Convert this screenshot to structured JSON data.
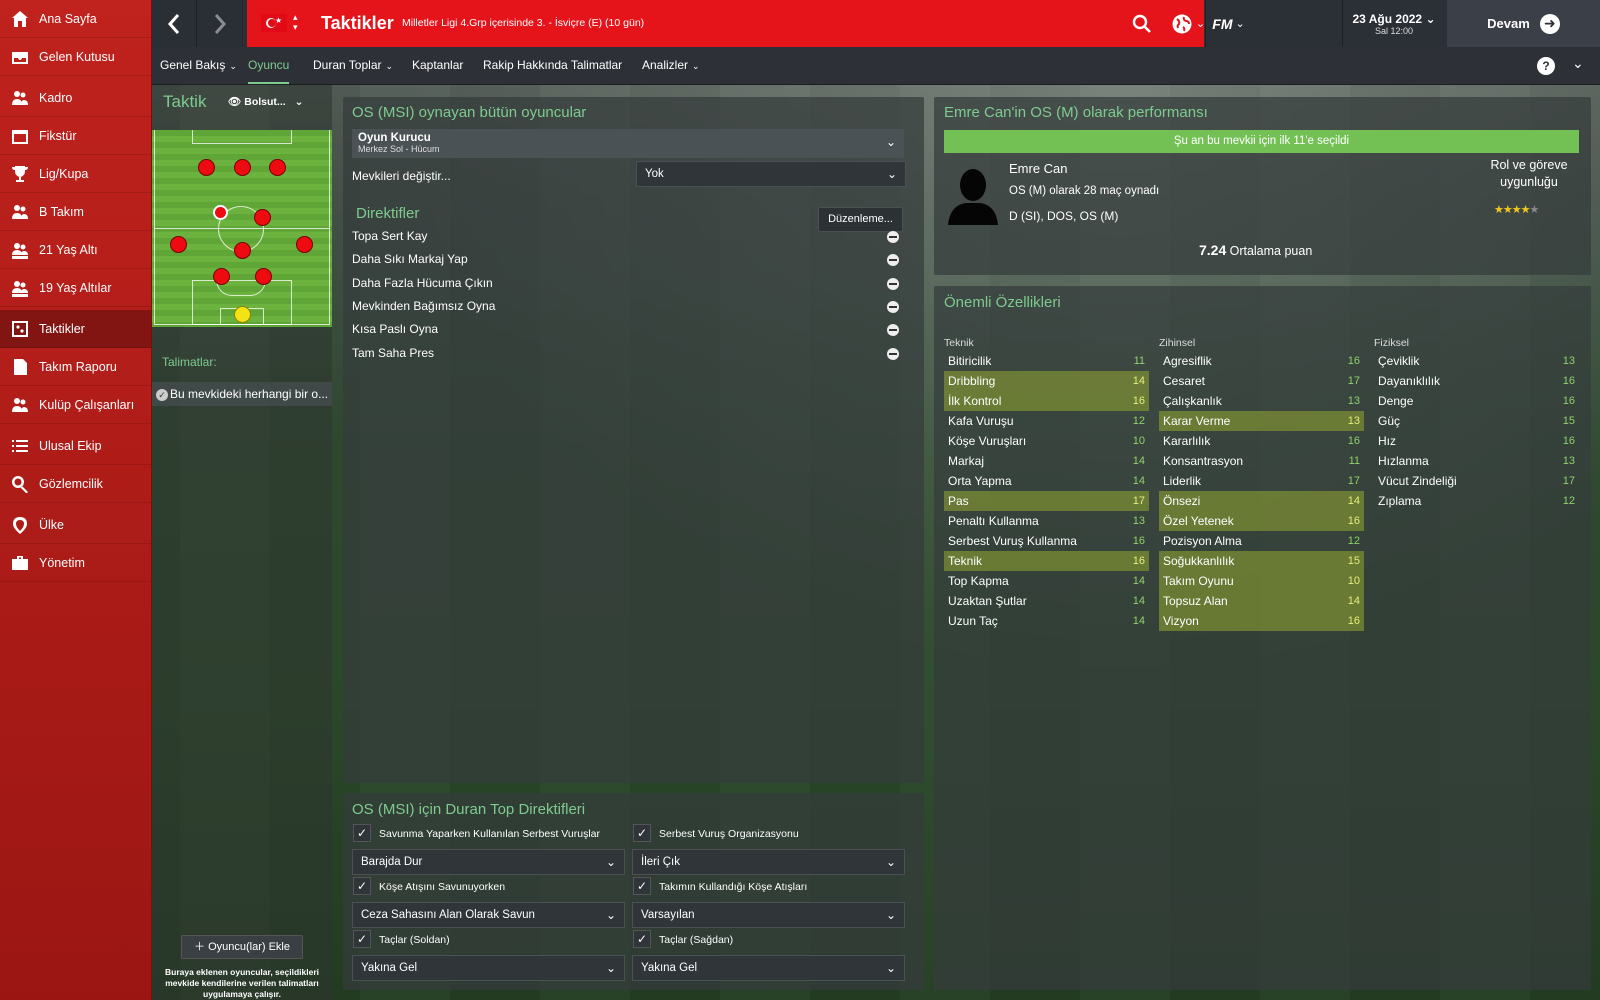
{
  "sidebar": {
    "items": [
      {
        "label": "Ana Sayfa",
        "icon": "home-icon"
      },
      {
        "label": "Gelen Kutusu",
        "icon": "inbox-icon"
      },
      {
        "label": "Kadro",
        "icon": "squad-icon"
      },
      {
        "label": "Fikstür",
        "icon": "calendar-icon"
      },
      {
        "label": "Lig/Kupa",
        "icon": "trophy-icon"
      },
      {
        "label": "B Takım",
        "icon": "team-b-icon"
      },
      {
        "label": "21 Yaş Altı",
        "icon": "u21-icon"
      },
      {
        "label": "19 Yaş Altılar",
        "icon": "u19-icon"
      },
      {
        "label": "Taktikler",
        "icon": "tactics-icon"
      },
      {
        "label": "Takım Raporu",
        "icon": "report-icon"
      },
      {
        "label": "Kulüp Çalışanları",
        "icon": "staff-icon"
      },
      {
        "label": "Ulusal Ekip",
        "icon": "list-icon"
      },
      {
        "label": "Gözlemcilik",
        "icon": "scout-search-icon"
      },
      {
        "label": "Ülke",
        "icon": "location-pin-icon"
      },
      {
        "label": "Yönetim",
        "icon": "briefcase-icon"
      }
    ],
    "active_index": 8
  },
  "topbar": {
    "title": "Taktikler",
    "subtitle": "Milletler Ligi 4.Grp içerisinde 3. - İsviçre (E) (10 gün)",
    "brand": "FM",
    "date": "23 Ağu 2022",
    "day_time": "Sal 12:00",
    "continue": "Devam"
  },
  "tabs": [
    {
      "label": "Genel Bakış",
      "dropdown": true
    },
    {
      "label": "Oyuncu",
      "dropdown": false,
      "active": true
    },
    {
      "label": "Duran Toplar",
      "dropdown": true
    },
    {
      "label": "Kaptanlar",
      "dropdown": false
    },
    {
      "label": "Rakip Hakkında Talimatlar",
      "dropdown": false
    },
    {
      "label": "Analizler",
      "dropdown": true
    }
  ],
  "tactic_panel": {
    "title": "Taktik",
    "view_select": "Bolsut...",
    "instructions_label": "Talimatlar:",
    "instruction_item": "Bu mevkideki herhangi bir o...",
    "add_button": "Oyuncu(lar) Ekle",
    "note": "Buraya eklenen oyuncular, seçildikleri mevkide kendilerine verilen talimatları uygulamaya çalışır."
  },
  "center": {
    "title": "OS (MSI) oynayan bütün oyuncular",
    "role_name": "Oyun Kurucu",
    "role_detail": "Merkez Sol - Hücum",
    "swap_label": "Mevkileri değiştir...",
    "swap_value": "Yok",
    "directives_title": "Direktifler",
    "edit_button": "Düzenleme...",
    "directives": [
      "Topa Sert Kay",
      "Daha Sıkı Markaj Yap",
      "Daha Fazla Hücuma Çıkın",
      "Mevkinden Bağımsız Oyna",
      "Kısa Paslı Oyna",
      "Tam Saha Pres"
    ]
  },
  "set_pieces": {
    "title": "OS (MSI) için Duran Top Direktifleri",
    "left": [
      {
        "check": "Savunma Yaparken Kullanılan Serbest Vuruşlar",
        "value": "Barajda Dur"
      },
      {
        "check": "Köşe Atışını Savunuyorken",
        "value": "Ceza Sahasını Alan Olarak Savun"
      },
      {
        "check": "Taçlar (Soldan)",
        "value": "Yakına Gel"
      }
    ],
    "right": [
      {
        "check": "Serbest Vuruş Organizasyonu",
        "value": "İleri Çık"
      },
      {
        "check": "Takımın Kullandığı Köşe Atışları",
        "value": "Varsayılan"
      },
      {
        "check": "Taçlar (Sağdan)",
        "value": "Yakına Gel"
      }
    ]
  },
  "performance": {
    "title": "Emre Can'in OS (M) olarak performansı",
    "banner": "Şu an bu mevkii için ilk 11'e seçildi",
    "player_name": "Emre Can",
    "appearances": "OS (M) olarak 28 maç oynadı",
    "positions": "D (SI), DOS, OS (M)",
    "suitability_label": "Rol ve göreve uygunluğu",
    "stars": 4,
    "stars_max": 5,
    "avg_value": "7.24",
    "avg_label": "Ortalama puan"
  },
  "attributes": {
    "title": "Önemli Özellikleri",
    "technical": {
      "heading": "Teknik",
      "rows": [
        {
          "n": "Bitiricilik",
          "v": "11",
          "hl": false
        },
        {
          "n": "Dribbling",
          "v": "14",
          "hl": true
        },
        {
          "n": "İlk Kontrol",
          "v": "16",
          "hl": true
        },
        {
          "n": "Kafa Vuruşu",
          "v": "12",
          "hl": false
        },
        {
          "n": "Köşe Vuruşları",
          "v": "10",
          "hl": false
        },
        {
          "n": "Markaj",
          "v": "14",
          "hl": false
        },
        {
          "n": "Orta Yapma",
          "v": "14",
          "hl": false
        },
        {
          "n": "Pas",
          "v": "17",
          "hl": true
        },
        {
          "n": "Penaltı Kullanma",
          "v": "13",
          "hl": false
        },
        {
          "n": "Serbest Vuruş Kullanma",
          "v": "16",
          "hl": false
        },
        {
          "n": "Teknik",
          "v": "16",
          "hl": true
        },
        {
          "n": "Top Kapma",
          "v": "14",
          "hl": false
        },
        {
          "n": "Uzaktan Şutlar",
          "v": "14",
          "hl": false
        },
        {
          "n": "Uzun Taç",
          "v": "14",
          "hl": false
        }
      ]
    },
    "mental": {
      "heading": "Zihinsel",
      "rows": [
        {
          "n": "Agresiflik",
          "v": "16",
          "hl": false
        },
        {
          "n": "Cesaret",
          "v": "17",
          "hl": false
        },
        {
          "n": "Çalışkanlık",
          "v": "13",
          "hl": false
        },
        {
          "n": "Karar Verme",
          "v": "13",
          "hl": true
        },
        {
          "n": "Kararlılık",
          "v": "16",
          "hl": false
        },
        {
          "n": "Konsantrasyon",
          "v": "11",
          "hl": false
        },
        {
          "n": "Liderlik",
          "v": "17",
          "hl": false
        },
        {
          "n": "Önsezi",
          "v": "14",
          "hl": true
        },
        {
          "n": "Özel Yetenek",
          "v": "16",
          "hl": true
        },
        {
          "n": "Pozisyon Alma",
          "v": "12",
          "hl": false
        },
        {
          "n": "Soğukkanlılık",
          "v": "15",
          "hl": true
        },
        {
          "n": "Takım Oyunu",
          "v": "10",
          "hl": true
        },
        {
          "n": "Topsuz Alan",
          "v": "14",
          "hl": true
        },
        {
          "n": "Vizyon",
          "v": "16",
          "hl": true
        }
      ]
    },
    "physical": {
      "heading": "Fiziksel",
      "rows": [
        {
          "n": "Çeviklik",
          "v": "13",
          "hl": false
        },
        {
          "n": "Dayanıklılık",
          "v": "16",
          "hl": false
        },
        {
          "n": "Denge",
          "v": "16",
          "hl": false
        },
        {
          "n": "Güç",
          "v": "15",
          "hl": false
        },
        {
          "n": "Hız",
          "v": "16",
          "hl": false
        },
        {
          "n": "Hızlanma",
          "v": "13",
          "hl": false
        },
        {
          "n": "Vücut Zindeliği",
          "v": "17",
          "hl": false
        },
        {
          "n": "Zıplama",
          "v": "12",
          "hl": false
        }
      ]
    }
  },
  "colors": {
    "sidebar": "#c0221d",
    "topbar_red": "#e5141b",
    "accent_green": "#7ecb8f",
    "highlight_row": "#8ca032"
  }
}
